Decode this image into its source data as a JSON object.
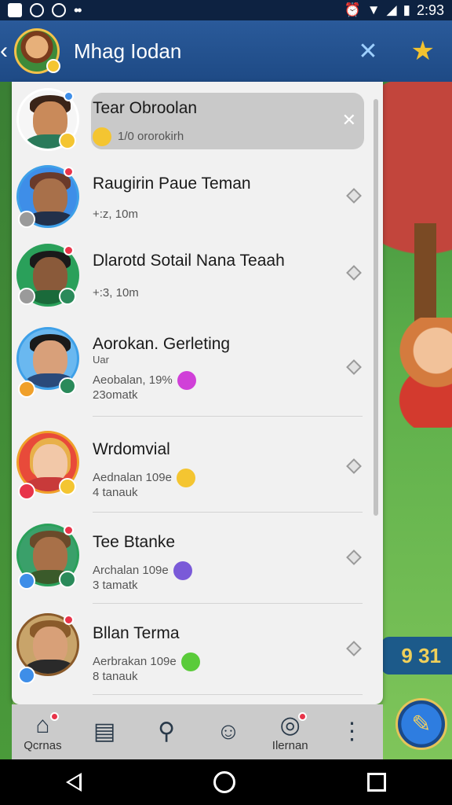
{
  "status_bar": {
    "time": "2:93",
    "icons": [
      "notification-icon",
      "clock-icon",
      "music-icon",
      "menu-dots-icon",
      "alarm-icon",
      "wifi-icon",
      "signal-icon",
      "battery-icon"
    ]
  },
  "app_bar": {
    "title": "Mhag Iodan",
    "icons": [
      "back-icon",
      "pin-icon",
      "star-icon"
    ]
  },
  "chats": [
    {
      "name": "Tear Obroolan",
      "line1": "1/0 ororokirh",
      "line2": "",
      "highlighted": true
    },
    {
      "name": "Raugirin Paue Teman",
      "line1": "+:z, 10m",
      "line2": ""
    },
    {
      "name": "Dlarotd Sotail Nana Teaah",
      "line1": "+:3, 10m",
      "line2": ""
    },
    {
      "name": "Aorokan. Gerleting",
      "tag": "Uar",
      "line1": "Aeobalan, 19%",
      "line2": "23omatk"
    },
    {
      "name": "Wrdomvial",
      "line1": "Aednalan 109e",
      "line2": "4 tanauk"
    },
    {
      "name": "Tee Btanke",
      "line1": "Archalan 109e",
      "line2": "3 tamatk"
    },
    {
      "name": "Bllan Terma",
      "line1": "Aerbrakan 109e",
      "line2": "8 tanauk"
    }
  ],
  "bottom_nav": [
    {
      "label": "Qcrnas",
      "icon": "home-icon"
    },
    {
      "label": "",
      "icon": "book-icon"
    },
    {
      "label": "",
      "icon": "search-icon"
    },
    {
      "label": "",
      "icon": "emoji-icon"
    },
    {
      "label": "Ilernan",
      "icon": "chat-icon"
    },
    {
      "label": "",
      "icon": "more-vertical-icon"
    }
  ],
  "game": {
    "score": "9 31"
  },
  "colors": {
    "app_bar": "#1e4a85",
    "panel": "#f1f1f1",
    "nav": "#cbcbcb",
    "badge_red": "#e8344a"
  }
}
